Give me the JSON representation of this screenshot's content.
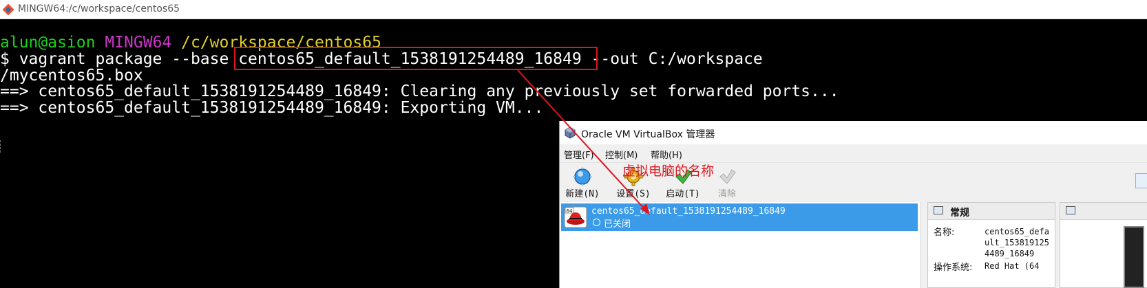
{
  "window": {
    "title": "MINGW64:/c/workspace/centos65",
    "icon": "git-bash-icon"
  },
  "terminal": {
    "prompt_user": "alun@asion",
    "prompt_env": "MINGW64",
    "prompt_path": "/c/workspace/centos65",
    "command_part1": "$ vagrant package --base ",
    "command_vm": "centos65_default_1538191254489_16849",
    "command_part2": " --out C:/workspace",
    "command_wrap": "/mycentos65.box",
    "output_1": "==> centos65_default_1538191254489_16849: Clearing any previously set forwarded ports...",
    "output_2": "==> centos65_default_1538191254489_16849: Exporting VM..."
  },
  "virtualbox": {
    "title": "Oracle VM VirtualBox 管理器",
    "menu": [
      "管理(F)",
      "控制(M)",
      "帮助(H)"
    ],
    "toolbar": [
      {
        "label": "新建(N)",
        "icon": "new-vm-icon"
      },
      {
        "label": "设置(S)",
        "icon": "settings-gear-icon"
      },
      {
        "label": "启动(T)",
        "icon": "start-arrow-icon"
      },
      {
        "label": "清除",
        "icon": "discard-icon"
      }
    ],
    "vm": {
      "name": "centos65_default_1538191254489_16849",
      "state": "已关闭",
      "badge": "64"
    },
    "details": {
      "section": "常规",
      "name_label": "名称:",
      "name_value_lines": [
        "centos65_defa",
        "ult_153819125",
        "4489_16849"
      ],
      "os_label": "操作系统:",
      "os_value": "Red Hat (64"
    }
  },
  "annotation": {
    "text": "虚拟电脑的名称",
    "color": "#e0141c"
  },
  "colors": {
    "terminal_bg": "#000000",
    "prompt_user": "#1bd11b",
    "prompt_env": "#c838c6",
    "prompt_path": "#e3d02a",
    "highlight": "#e0141c",
    "selection": "#3b9be8"
  }
}
